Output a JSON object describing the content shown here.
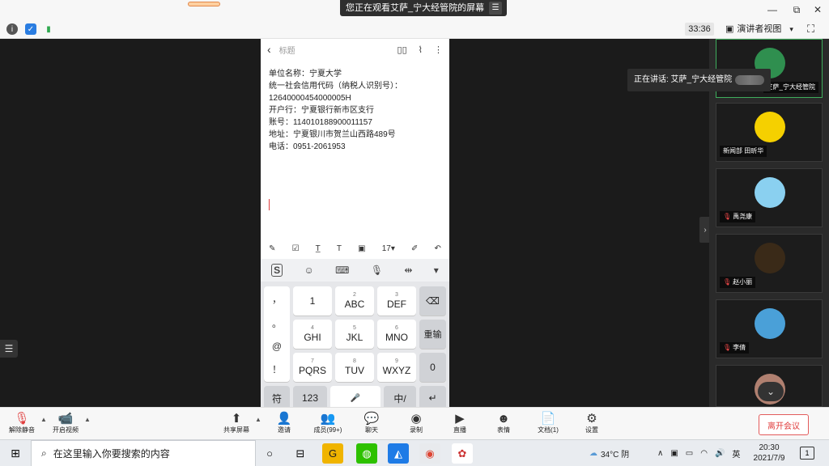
{
  "top": {
    "viewing_text": "您正在观看艾萨_宁大经管院的屏幕",
    "menu_icon": "menu-icon",
    "minimize": "—",
    "restore": "⧉",
    "close": "✕"
  },
  "toolbar": {
    "timer": "33:36",
    "view_mode": "演讲者视图",
    "view_caret": "▾"
  },
  "phone": {
    "header_title": "标题",
    "lines": [
      "单位名称：宁夏大学",
      "统一社会信用代码（纳税人识别号）：",
      "12640000454000005H",
      "开户行：宁夏银行新市区支行",
      "账号：114010188900011157",
      "地址：宁夏银川市贺兰山西路489号",
      "电话：0951-2061953"
    ],
    "font_size": "17▾",
    "keys": {
      "k1": "1",
      "k2": "ABC",
      "k2s": "2",
      "k3": "DEF",
      "k3s": "3",
      "k4": "GHI",
      "k4s": "4",
      "k5": "JKL",
      "k5s": "5",
      "k6": "MNO",
      "k6s": "6",
      "k7": "PQRS",
      "k7s": "7",
      "k8": "TUV",
      "k8s": "8",
      "k9": "WXYZ",
      "k9s": "9",
      "k0": "0",
      "backspace": "⌫",
      "retype": "重输",
      "symbols": [
        "，",
        "。",
        "@",
        "！"
      ],
      "sym": "符",
      "num": "123",
      "space": "🎤",
      "lang": "中/",
      "enter": "↵"
    }
  },
  "speaking": {
    "label": "正在讲话: 艾萨_宁大经管院"
  },
  "participants": [
    {
      "name": "艾萨_宁大经管院",
      "muted": false,
      "avatar_color": "#2f8f4f"
    },
    {
      "name": "新闻部 田昕华",
      "muted": false,
      "avatar_color": "#f5d000"
    },
    {
      "name": "禹尧康",
      "muted": true,
      "avatar_color": "#8ad0f0"
    },
    {
      "name": "赵小丽",
      "muted": true,
      "avatar_color": "#3a2a18"
    },
    {
      "name": "李倩",
      "muted": true,
      "avatar_color": "#4aa0d8"
    },
    {
      "name": "",
      "muted": false,
      "avatar_color": "#b08070"
    }
  ],
  "controls": {
    "unmute": "解除静音",
    "start_video": "开启视频",
    "share_screen": "共享屏幕",
    "invite": "邀请",
    "members": "成员(99+)",
    "chat": "聊天",
    "record": "录制",
    "live": "直播",
    "emoji": "表情",
    "docs": "文档(1)",
    "settings": "设置",
    "leave": "离开会议"
  },
  "taskbar": {
    "search_placeholder": "在这里输入你要搜索的内容",
    "weather": "34°C 阴",
    "ime": "英",
    "time": "20:30",
    "date": "2021/7/9",
    "notification_count": "1"
  }
}
